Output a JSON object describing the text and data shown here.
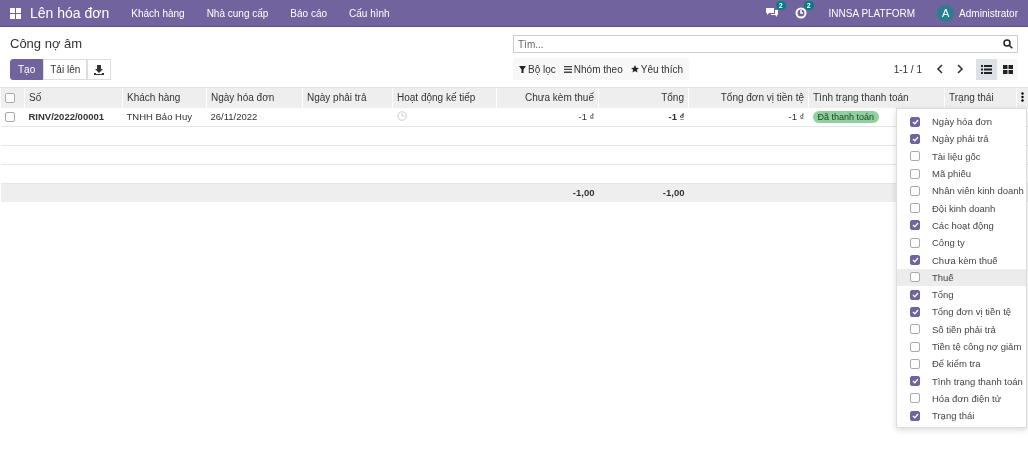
{
  "navbar": {
    "app_title": "Lên hóa đơn",
    "menu": [
      "Khách hàng",
      "Nhà cung cấp",
      "Báo cáo",
      "Cấu hình"
    ],
    "chat_badge": "2",
    "activity_badge": "2",
    "company": "INNSA PLATFORM",
    "avatar_letter": "A",
    "user": "Administrator"
  },
  "breadcrumb": "Công nợ âm",
  "buttons": {
    "create": "Tạo",
    "upload": "Tải lên"
  },
  "search": {
    "placeholder": "Tìm..."
  },
  "filters": [
    {
      "kind": "filter",
      "label": "Bộ lọc"
    },
    {
      "kind": "group",
      "label": "Nhóm theo"
    },
    {
      "kind": "favorite",
      "label": "Yêu thích"
    }
  ],
  "pager": "1-1 / 1",
  "views": [
    {
      "kind": "list",
      "selected": true
    },
    {
      "kind": "kanban",
      "selected": false
    }
  ],
  "table": {
    "select_all_checked": false,
    "columns": [
      {
        "label": "Số",
        "kind": "text"
      },
      {
        "label": "Khách hàng",
        "kind": "text"
      },
      {
        "label": "Ngày hóa đơn",
        "kind": "text"
      },
      {
        "label": "Ngày phải trả",
        "kind": "text"
      },
      {
        "label": "Hoạt động kế tiếp",
        "kind": "text"
      },
      {
        "label": "Chưa kèm thuế",
        "kind": "number",
        "total": "-1,00"
      },
      {
        "label": "Tổng",
        "kind": "number",
        "total": "-1,00"
      },
      {
        "label": "Tổng đơn vị tiền tệ",
        "kind": "number"
      },
      {
        "label": "Tình trạng thanh toán",
        "kind": "text"
      },
      {
        "label": "Trạng thái",
        "kind": "text"
      }
    ],
    "rows": [
      {
        "checked": false,
        "number": "RINV/2022/00001",
        "customer": "TNHH Bảo Huy",
        "invoice_date": "26/11/2022",
        "untaxed": "-1 ₫",
        "total": "-1 ₫",
        "total_currency": "-1 ₫",
        "payment_status": "Đã thanh toán"
      }
    ]
  },
  "column_menu": [
    {
      "label": "Ngày hóa đơn",
      "checked": true,
      "hovered": false
    },
    {
      "label": "Ngày phải trả",
      "checked": true,
      "hovered": false
    },
    {
      "label": "Tài liệu gốc",
      "checked": false,
      "hovered": false
    },
    {
      "label": "Mã phiếu",
      "checked": false,
      "hovered": false
    },
    {
      "label": "Nhân viên kinh doanh",
      "checked": false,
      "hovered": false
    },
    {
      "label": "Đội kinh doanh",
      "checked": false,
      "hovered": false
    },
    {
      "label": "Các hoạt động",
      "checked": true,
      "hovered": false
    },
    {
      "label": "Công ty",
      "checked": false,
      "hovered": false
    },
    {
      "label": "Chưa kèm thuế",
      "checked": true,
      "hovered": false
    },
    {
      "label": "Thuế",
      "checked": false,
      "hovered": true
    },
    {
      "label": "Tổng",
      "checked": true,
      "hovered": false
    },
    {
      "label": "Tổng đơn vị tiền tệ",
      "checked": true,
      "hovered": false
    },
    {
      "label": "Số tiền phải trả",
      "checked": false,
      "hovered": false
    },
    {
      "label": "Tiền tệ công nợ giảm",
      "checked": false,
      "hovered": false
    },
    {
      "label": "Để kiểm tra",
      "checked": false,
      "hovered": false
    },
    {
      "label": "Tình trạng thanh toán",
      "checked": true,
      "hovered": false
    },
    {
      "label": "Hóa đơn điện tử",
      "checked": false,
      "hovered": false
    },
    {
      "label": "Trạng thái",
      "checked": true,
      "hovered": false
    }
  ]
}
